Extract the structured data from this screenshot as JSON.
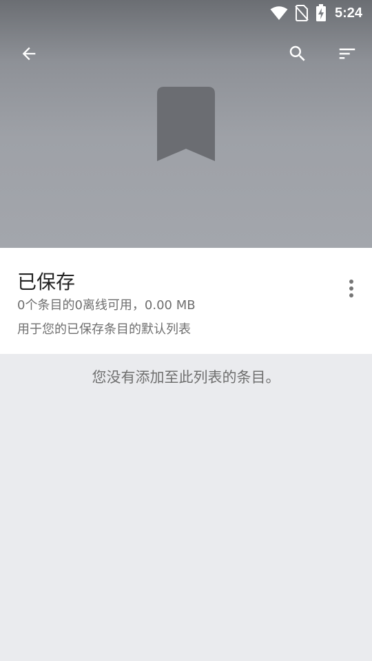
{
  "status_bar": {
    "time": "5:24",
    "icons": [
      "wifi-icon",
      "no-sim-icon",
      "battery-charging-icon"
    ]
  },
  "toolbar": {
    "icons": [
      "back-arrow-icon",
      "search-icon",
      "sort-icon"
    ]
  },
  "header": {
    "icon": "bookmark-icon"
  },
  "list": {
    "title": "已保存",
    "meta": "0个条目的0离线可用，0.00 MB",
    "description": "用于您的已保存条目的默认列表",
    "menu_icon": "more-vert-icon"
  },
  "empty_state": {
    "message": "您没有添加至此列表的条目。"
  },
  "colors": {
    "header_top": "#6b6e73",
    "header_bottom": "#a3a6ac",
    "bookmark": "#6b6d72",
    "body_background": "#eaebee",
    "card_background": "#ffffff"
  }
}
